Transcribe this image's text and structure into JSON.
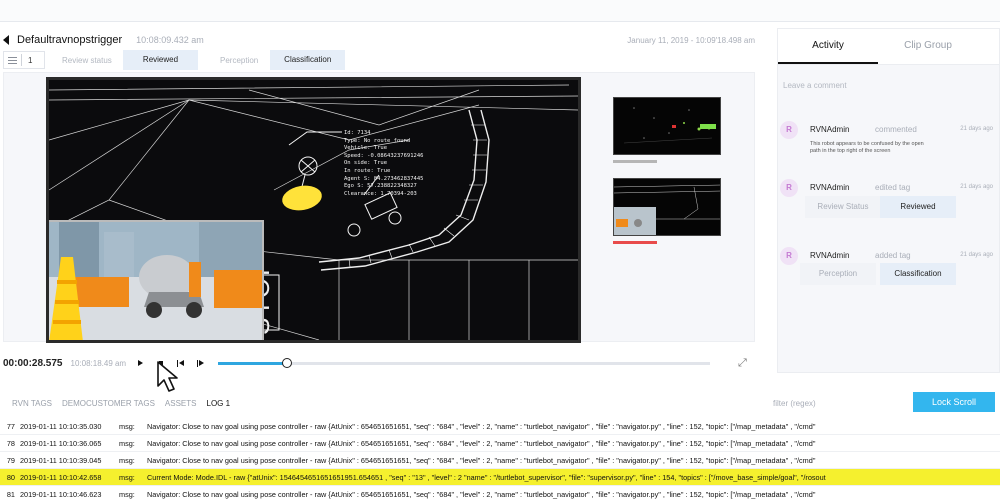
{
  "header": {
    "title": "Defaultravnopstrigger",
    "time": "10:08:09.432 am",
    "range": "January 11, 2019 - 10:09'18.498 am"
  },
  "toolbar": {
    "list_count": "1",
    "review_status_label": "Review status",
    "review_value": "Reviewed",
    "perception_label": "Perception",
    "classification_value": "Classification"
  },
  "overlay": {
    "lines": [
      "Id: 7134",
      "Type: No route found",
      "Vehicle: True",
      "Speed: -0.08643237691246",
      "On side: True",
      "In route: True",
      "Agent S: 84.273462837445",
      "Ego S: 57.238822348327",
      "Clearance: 1.70394-203"
    ]
  },
  "player": {
    "time": "00:00:28.575",
    "clock": "10:08:18.49 am",
    "progress": 0.14
  },
  "log_tabs": {
    "items": [
      "RVN TAGS",
      "DEMOCUSTOMER TAGS",
      "ASSETS",
      "LOG 1"
    ],
    "active_index": 3,
    "filter_placeholder": "filter (regex)",
    "lock_label": "Lock Scroll"
  },
  "log_rows": [
    {
      "n": "77",
      "t": "2019-01-11 10:10:35.030",
      "k": "msg:",
      "m": "Navigator: Close to nav goal using pose controller - raw {AtUnix\" : 654651651651, \"seq\" : \"684\" , \"level\" : 2, \"name\" : \"turtlebot_navigator\" , \"file\" : \"navigator.py\" , \"line\" : 152, \"topic\": [\"/map_metadata\" , \"/cmd\"",
      "hl": false
    },
    {
      "n": "78",
      "t": "2019-01-11 10:10:36.065",
      "k": "msg:",
      "m": "Navigator: Close to nav goal using pose controller - raw {AtUnix\" : 654651651651, \"seq\" : \"684\" , \"level\" : 2, \"name\" : \"turtlebot_navigator\" , \"file\" : \"navigator.py\" , \"line\" : 152, \"topic\": [\"/map_metadata\" , \"/cmd\"",
      "hl": false
    },
    {
      "n": "79",
      "t": "2019-01-11 10:10:39.045",
      "k": "msg:",
      "m": "Navigator: Close to nav goal using pose controller - raw {AtUnix\" : 654651651651, \"seq\" : \"684\" , \"level\" : 2, \"name\" : \"turtlebot_navigator\" , \"file\" : \"navigator.py\" , \"line\" : 152, \"topic\": [\"/map_metadata\" , \"/cmd\"",
      "hl": false
    },
    {
      "n": "80",
      "t": "2019-01-11 10:10:42.658",
      "k": "msg:",
      "m": "Current Mode: Mode.IDL - raw {\"atUnix\": 15464546516516​51951.654651 , \"seq\" : \"13\" , \"level\" : 2 \"name\" : \"/turtlebot_supervisor\", \"file\": \"supervisor.py\", \"line\" : 154, \"topics\" : [\"/move_base_simple/goal\", \"/rosout",
      "hl": true
    },
    {
      "n": "81",
      "t": "2019-01-11 10:10:46.623",
      "k": "msg:",
      "m": "Navigator: Close to nav goal using pose controller - raw {AtUnix\" : 654651651651, \"seq\" : \"684\" , \"level\" : 2, \"name\" : \"turtlebot_navigator\" , \"file\" : \"navigator.py\" , \"line\" : 152, \"topic\": [\"/map_metadata\" , \"/cmd\"",
      "hl": false
    }
  ],
  "sidebar": {
    "tabs": [
      "Activity",
      "Clip Group"
    ],
    "active_tab": 0,
    "comment_placeholder": "Leave a comment",
    "activities": [
      {
        "initial": "R",
        "user": "RVNAdmin",
        "verb": "commented",
        "ago": "21 days ago",
        "text": "This robot appears to be confused by the open path in the top right of the screen",
        "chips": []
      },
      {
        "initial": "R",
        "user": "RVNAdmin",
        "verb": "edited tag",
        "ago": "21 days ago",
        "text": "",
        "chips": [
          "Review Status",
          "Reviewed"
        ]
      },
      {
        "initial": "R",
        "user": "RVNAdmin",
        "verb": "added tag",
        "ago": "21 days ago",
        "text": "",
        "chips": [
          "Perception",
          "Classification"
        ]
      }
    ]
  },
  "colors": {
    "accent": "#33b6ee",
    "highlight": "#f5f02e",
    "chip_bg": "#e6eef8",
    "avatar_bg": "#f0e2f6"
  },
  "icons": [
    "back-icon",
    "list-icon",
    "play-icon",
    "stop-icon",
    "prev-icon",
    "next-icon",
    "expand-icon",
    "cursor-icon"
  ]
}
